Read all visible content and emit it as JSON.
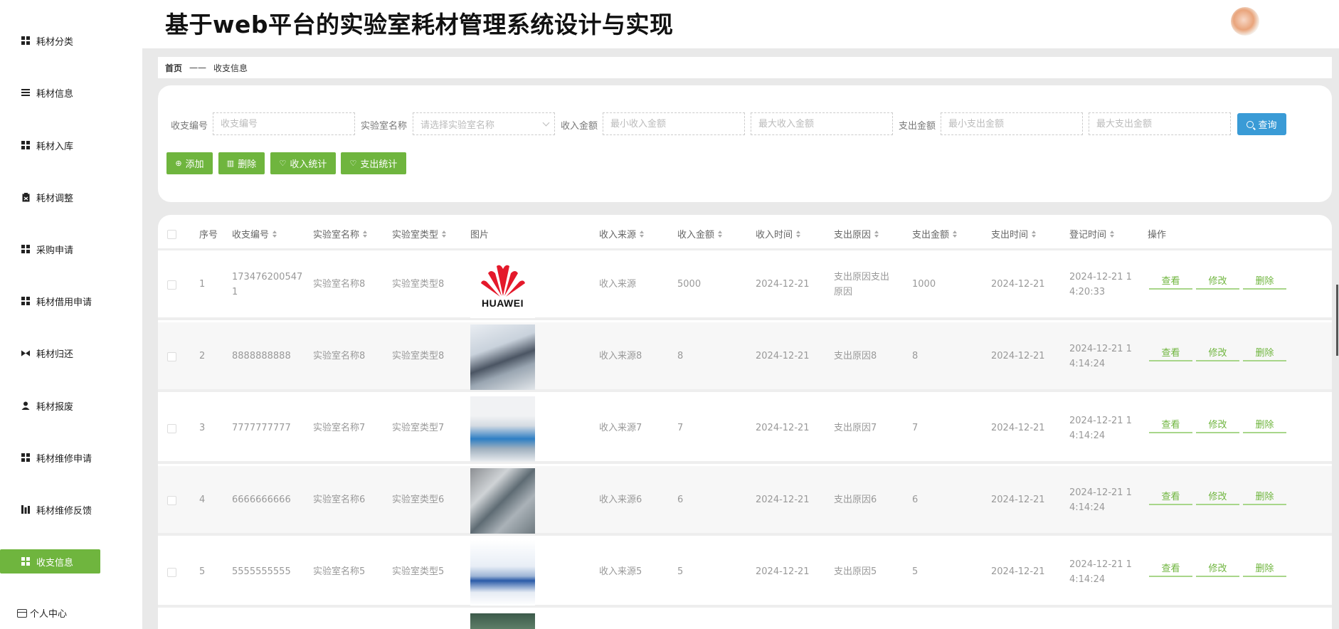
{
  "app": {
    "title": "基于web平台的实验室耗材管理系统设计与实现"
  },
  "sidebar": {
    "items": [
      {
        "label": "耗材分类",
        "icon": "grid-icon"
      },
      {
        "label": "耗材信息",
        "icon": "list-icon"
      },
      {
        "label": "耗材入库",
        "icon": "grid-icon"
      },
      {
        "label": "耗材调整",
        "icon": "clipboard-icon"
      },
      {
        "label": "采购申请",
        "icon": "grid-icon"
      },
      {
        "label": "耗材借用申请",
        "icon": "grid-icon"
      },
      {
        "label": "耗材归还",
        "icon": "swap-icon"
      },
      {
        "label": "耗材报废",
        "icon": "user-icon"
      },
      {
        "label": "耗材维修申请",
        "icon": "grid-icon"
      },
      {
        "label": "耗材维修反馈",
        "icon": "bars-icon"
      },
      {
        "label": "收支信息",
        "icon": "grid-icon",
        "active": true
      }
    ],
    "profile_label": "个人中心"
  },
  "breadcrumb": {
    "home": "首页",
    "separator": "——",
    "current": "收支信息"
  },
  "search": {
    "code_label": "收支编号",
    "code_placeholder": "收支编号",
    "lab_label": "实验室名称",
    "lab_placeholder": "请选择实验室名称",
    "income_label": "收入金额",
    "income_min_placeholder": "最小收入金额",
    "income_max_placeholder": "最大收入金额",
    "expense_label": "支出金额",
    "expense_min_placeholder": "最小支出金额",
    "expense_max_placeholder": "最大支出金额",
    "query_label": "查询"
  },
  "actions": {
    "add": "添加",
    "delete": "删除",
    "income_stats": "收入统计",
    "expense_stats": "支出统计"
  },
  "table": {
    "headers": {
      "index": "序号",
      "code": "收支编号",
      "lab_name": "实验室名称",
      "lab_type": "实验室类型",
      "image": "图片",
      "income_source": "收入来源",
      "income_amount": "收入金额",
      "income_time": "收入时间",
      "expense_reason": "支出原因",
      "expense_amount": "支出金额",
      "expense_time": "支出时间",
      "register_time": "登记时间",
      "ops": "操作"
    },
    "op_labels": {
      "view": "查看",
      "edit": "修改",
      "delete": "删除"
    },
    "image_logo_text": "HUAWEI",
    "rows": [
      {
        "index": "1",
        "code_l1": "173476200547",
        "code_l2": "1",
        "lab_name": "实验室名称8",
        "lab_type": "实验室类型8",
        "image": "huawei-logo",
        "income_source": "收入来源",
        "income_amount": "5000",
        "income_time": "2024-12-21",
        "expense_l1": "支出原因支出",
        "expense_l2": "原因",
        "expense_amount": "1000",
        "expense_time": "2024-12-21",
        "reg_l1": "2024-12-21 1",
        "reg_l2": "4:20:33"
      },
      {
        "index": "2",
        "code_l1": "8888888888",
        "code_l2": "",
        "lab_name": "实验室名称8",
        "lab_type": "实验室类型8",
        "image": "lab-photo-1",
        "income_source": "收入来源8",
        "income_amount": "8",
        "income_time": "2024-12-21",
        "expense_l1": "支出原因8",
        "expense_l2": "",
        "expense_amount": "8",
        "expense_time": "2024-12-21",
        "reg_l1": "2024-12-21 1",
        "reg_l2": "4:14:24"
      },
      {
        "index": "3",
        "code_l1": "7777777777",
        "code_l2": "",
        "lab_name": "实验室名称7",
        "lab_type": "实验室类型7",
        "image": "lab-photo-2",
        "income_source": "收入来源7",
        "income_amount": "7",
        "income_time": "2024-12-21",
        "expense_l1": "支出原因7",
        "expense_l2": "",
        "expense_amount": "7",
        "expense_time": "2024-12-21",
        "reg_l1": "2024-12-21 1",
        "reg_l2": "4:14:24"
      },
      {
        "index": "4",
        "code_l1": "6666666666",
        "code_l2": "",
        "lab_name": "实验室名称6",
        "lab_type": "实验室类型6",
        "image": "lab-photo-3",
        "income_source": "收入来源6",
        "income_amount": "6",
        "income_time": "2024-12-21",
        "expense_l1": "支出原因6",
        "expense_l2": "",
        "expense_amount": "6",
        "expense_time": "2024-12-21",
        "reg_l1": "2024-12-21 1",
        "reg_l2": "4:14:24"
      },
      {
        "index": "5",
        "code_l1": "5555555555",
        "code_l2": "",
        "lab_name": "实验室名称5",
        "lab_type": "实验室类型5",
        "image": "lab-photo-4",
        "income_source": "收入来源5",
        "income_amount": "5",
        "income_time": "2024-12-21",
        "expense_l1": "支出原因5",
        "expense_l2": "",
        "expense_amount": "5",
        "expense_time": "2024-12-21",
        "reg_l1": "2024-12-21 1",
        "reg_l2": "4:14:24"
      }
    ]
  },
  "colors": {
    "accent_green": "#6fb53e",
    "query_blue": "#3a9bd6"
  }
}
